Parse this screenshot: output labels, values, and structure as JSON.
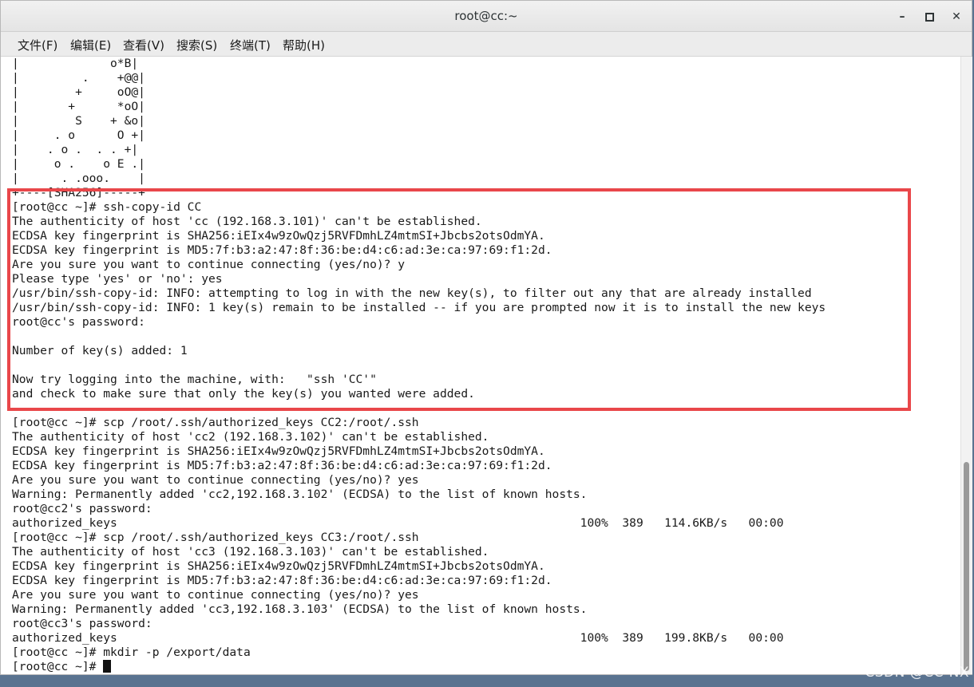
{
  "window": {
    "title": "root@cc:~",
    "minimize": "–",
    "close": "✕"
  },
  "menu": [
    "文件(F)",
    "编辑(E)",
    "查看(V)",
    "搜索(S)",
    "终端(T)",
    "帮助(H)"
  ],
  "terminal_lines": [
    "|             o*B|",
    "|         .    +@@|",
    "|        +     oO@|",
    "|       +      *oO|",
    "|        S    + &o|",
    "|     . o      O +|",
    "|    . o .  . . +|",
    "|     o .    o E .|",
    "|      . .ooo.    |",
    "+----[SHA256]-----+",
    "[root@cc ~]# ssh-copy-id CC",
    "The authenticity of host 'cc (192.168.3.101)' can't be established.",
    "ECDSA key fingerprint is SHA256:iEIx4w9zOwQzj5RVFDmhLZ4mtmSI+Jbcbs2otsOdmYA.",
    "ECDSA key fingerprint is MD5:7f:b3:a2:47:8f:36:be:d4:c6:ad:3e:ca:97:69:f1:2d.",
    "Are you sure you want to continue connecting (yes/no)? y",
    "Please type 'yes' or 'no': yes",
    "/usr/bin/ssh-copy-id: INFO: attempting to log in with the new key(s), to filter out any that are already installed",
    "/usr/bin/ssh-copy-id: INFO: 1 key(s) remain to be installed -- if you are prompted now it is to install the new keys",
    "root@cc's password:",
    "",
    "Number of key(s) added: 1",
    "",
    "Now try logging into the machine, with:   \"ssh 'CC'\"",
    "and check to make sure that only the key(s) you wanted were added.",
    "",
    "[root@cc ~]# scp /root/.ssh/authorized_keys CC2:/root/.ssh",
    "The authenticity of host 'cc2 (192.168.3.102)' can't be established.",
    "ECDSA key fingerprint is SHA256:iEIx4w9zOwQzj5RVFDmhLZ4mtmSI+Jbcbs2otsOdmYA.",
    "ECDSA key fingerprint is MD5:7f:b3:a2:47:8f:36:be:d4:c6:ad:3e:ca:97:69:f1:2d.",
    "Are you sure you want to continue connecting (yes/no)? yes",
    "Warning: Permanently added 'cc2,192.168.3.102' (ECDSA) to the list of known hosts.",
    "root@cc2's password:",
    "authorized_keys                                                                  100%  389   114.6KB/s   00:00",
    "[root@cc ~]# scp /root/.ssh/authorized_keys CC3:/root/.ssh",
    "The authenticity of host 'cc3 (192.168.3.103)' can't be established.",
    "ECDSA key fingerprint is SHA256:iEIx4w9zOwQzj5RVFDmhLZ4mtmSI+Jbcbs2otsOdmYA.",
    "ECDSA key fingerprint is MD5:7f:b3:a2:47:8f:36:be:d4:c6:ad:3e:ca:97:69:f1:2d.",
    "Are you sure you want to continue connecting (yes/no)? yes",
    "Warning: Permanently added 'cc3,192.168.3.103' (ECDSA) to the list of known hosts.",
    "root@cc3's password:",
    "authorized_keys                                                                  100%  389   199.8KB/s   00:00",
    "[root@cc ~]# mkdir -p /export/data",
    "[root@cc ~]# "
  ],
  "watermark": "CSDN @CC-NX",
  "colors": {
    "highlight": "#e9474a",
    "terminal_bg": "#ffffff",
    "text": "#1a1a1a"
  }
}
